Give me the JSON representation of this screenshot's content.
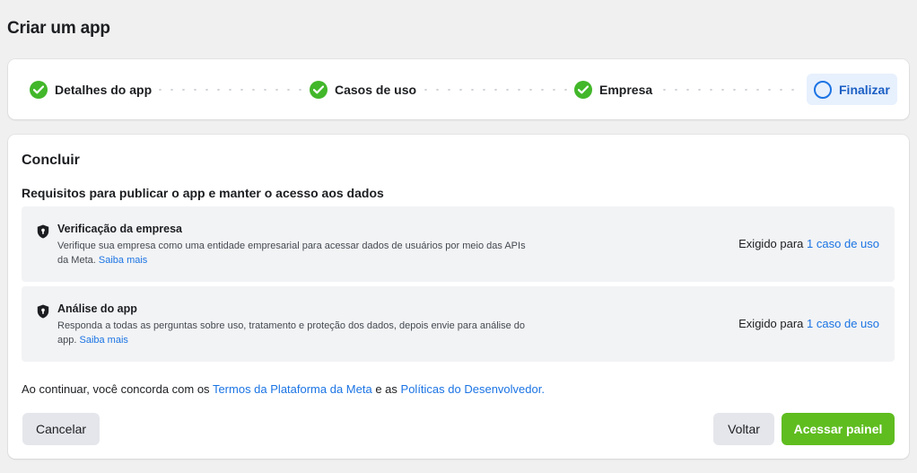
{
  "page": {
    "title": "Criar um app"
  },
  "stepper": {
    "steps": [
      {
        "label": "Detalhes do app",
        "status": "complete"
      },
      {
        "label": "Casos de uso",
        "status": "complete"
      },
      {
        "label": "Empresa",
        "status": "complete"
      },
      {
        "label": "Finalizar",
        "status": "current"
      }
    ]
  },
  "main": {
    "section_title": "Concluir",
    "requirements_heading": "Requisitos para publicar o app e manter o acesso aos dados",
    "requirements": [
      {
        "icon": "shield-lock-icon",
        "title": "Verificação da empresa",
        "description": "Verifique sua empresa como uma entidade empresarial para acessar dados de usuários por meio das APIs da Meta.",
        "learn_more": "Saiba mais",
        "required_prefix": "Exigido para",
        "required_link": "1 caso de uso"
      },
      {
        "icon": "shield-lock-icon",
        "title": "Análise do app",
        "description": "Responda a todas as perguntas sobre uso, tratamento e proteção dos dados, depois envie para análise do app.",
        "learn_more": "Saiba mais",
        "required_prefix": "Exigido para",
        "required_link": "1 caso de uso"
      }
    ],
    "consent": {
      "prefix": "Ao continuar, você concorda com os",
      "terms_link": "Termos da Plataforma da Meta",
      "middle": "e as",
      "policies_link": "Políticas do Desenvolvedor."
    }
  },
  "actions": {
    "cancel_label": "Cancelar",
    "back_label": "Voltar",
    "primary_label": "Acessar painel"
  },
  "colors": {
    "success": "#42b72a",
    "link": "#1b74e4",
    "primary_button": "#5fbd1f",
    "active_step_bg": "#e7f0fd"
  }
}
